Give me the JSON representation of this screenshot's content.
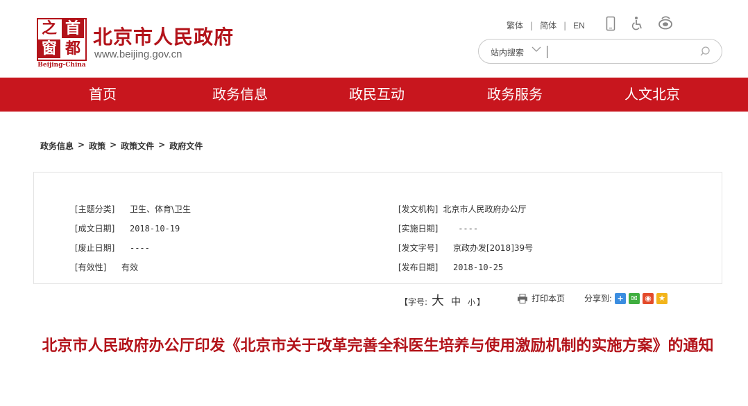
{
  "logo": {
    "chars": [
      "之",
      "首",
      "窗",
      "都"
    ],
    "subtitle": "Beijing-China"
  },
  "header": {
    "title": "北京市人民政府",
    "url": "www.beijing.gov.cn"
  },
  "toplinks": {
    "traditional": "繁体",
    "simplified": "简体",
    "english": "EN",
    "separator": "|"
  },
  "search": {
    "scope": "站内搜索",
    "placeholder": ""
  },
  "nav": {
    "items": [
      "首页",
      "政务信息",
      "政民互动",
      "政务服务",
      "人文北京"
    ]
  },
  "breadcrumb": {
    "items": [
      "政务信息",
      "政策",
      "政策文件",
      "政府文件"
    ],
    "separator": ">"
  },
  "meta": {
    "topic_label": "[主题分类]",
    "topic_value": "卫生、体育\\卫生",
    "issuer_label": "[发文机构]",
    "issuer_value": "北京市人民政府办公厅",
    "created_label": "[成文日期]",
    "created_value": "2018-10-19",
    "effective_label": "[实施日期]",
    "effective_value": "----",
    "repeal_label": "[废止日期]",
    "repeal_value": "----",
    "doc_no_label": "[发文字号]",
    "doc_no_value": "京政办发[2018]39号",
    "validity_label": "[有效性]",
    "validity_value": "有效",
    "published_label": "[发布日期]",
    "published_value": "2018-10-25"
  },
  "tools": {
    "font_size_label": "【字号:",
    "font_big": "大",
    "font_mid": "中",
    "font_small": "小",
    "font_close": "】",
    "print_label": "打印本页",
    "share_label": "分享到:"
  },
  "document": {
    "title": "北京市人民政府办公厅印发《北京市关于改革完善全科医生培养与使用激励机制的实施方案》的通知"
  },
  "colors": {
    "brand_red": "#c8161e",
    "title_red": "#b3131a"
  }
}
